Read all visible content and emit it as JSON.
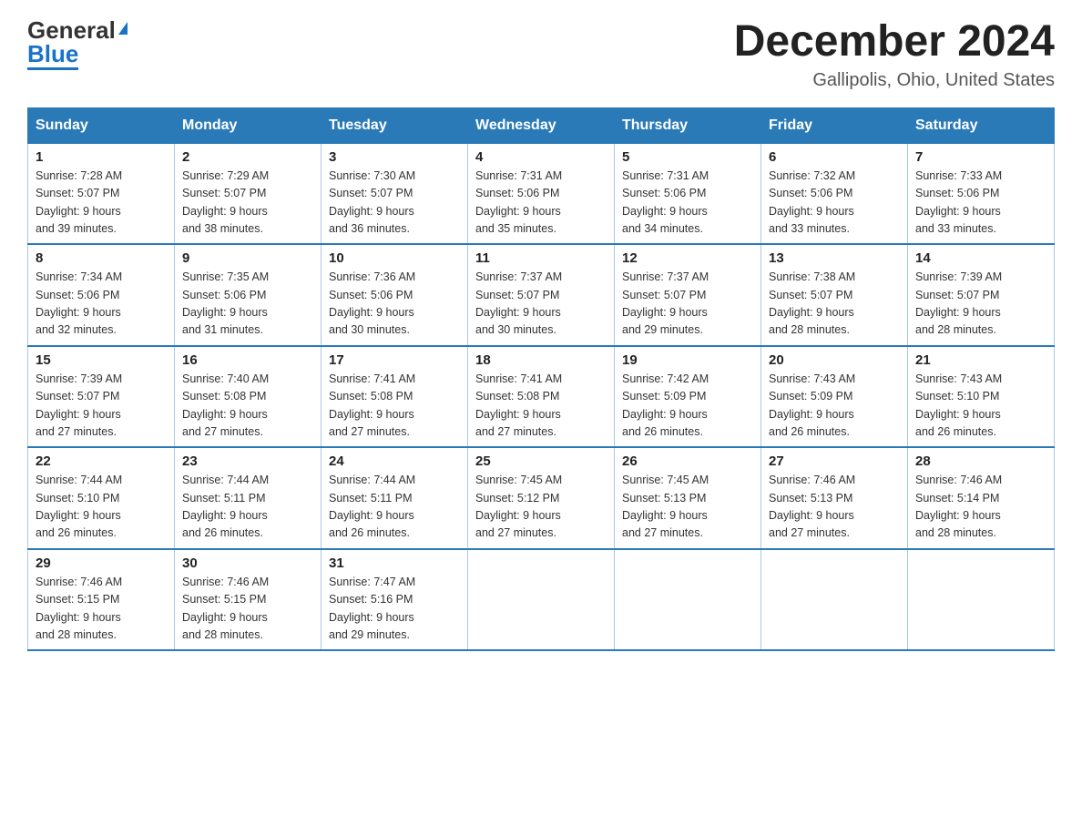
{
  "logo": {
    "general": "General",
    "blue": "Blue"
  },
  "title": "December 2024",
  "location": "Gallipolis, Ohio, United States",
  "days_of_week": [
    "Sunday",
    "Monday",
    "Tuesday",
    "Wednesday",
    "Thursday",
    "Friday",
    "Saturday"
  ],
  "weeks": [
    [
      {
        "day": "1",
        "sunrise": "7:28 AM",
        "sunset": "5:07 PM",
        "daylight": "9 hours and 39 minutes."
      },
      {
        "day": "2",
        "sunrise": "7:29 AM",
        "sunset": "5:07 PM",
        "daylight": "9 hours and 38 minutes."
      },
      {
        "day": "3",
        "sunrise": "7:30 AM",
        "sunset": "5:07 PM",
        "daylight": "9 hours and 36 minutes."
      },
      {
        "day": "4",
        "sunrise": "7:31 AM",
        "sunset": "5:06 PM",
        "daylight": "9 hours and 35 minutes."
      },
      {
        "day": "5",
        "sunrise": "7:31 AM",
        "sunset": "5:06 PM",
        "daylight": "9 hours and 34 minutes."
      },
      {
        "day": "6",
        "sunrise": "7:32 AM",
        "sunset": "5:06 PM",
        "daylight": "9 hours and 33 minutes."
      },
      {
        "day": "7",
        "sunrise": "7:33 AM",
        "sunset": "5:06 PM",
        "daylight": "9 hours and 33 minutes."
      }
    ],
    [
      {
        "day": "8",
        "sunrise": "7:34 AM",
        "sunset": "5:06 PM",
        "daylight": "9 hours and 32 minutes."
      },
      {
        "day": "9",
        "sunrise": "7:35 AM",
        "sunset": "5:06 PM",
        "daylight": "9 hours and 31 minutes."
      },
      {
        "day": "10",
        "sunrise": "7:36 AM",
        "sunset": "5:06 PM",
        "daylight": "9 hours and 30 minutes."
      },
      {
        "day": "11",
        "sunrise": "7:37 AM",
        "sunset": "5:07 PM",
        "daylight": "9 hours and 30 minutes."
      },
      {
        "day": "12",
        "sunrise": "7:37 AM",
        "sunset": "5:07 PM",
        "daylight": "9 hours and 29 minutes."
      },
      {
        "day": "13",
        "sunrise": "7:38 AM",
        "sunset": "5:07 PM",
        "daylight": "9 hours and 28 minutes."
      },
      {
        "day": "14",
        "sunrise": "7:39 AM",
        "sunset": "5:07 PM",
        "daylight": "9 hours and 28 minutes."
      }
    ],
    [
      {
        "day": "15",
        "sunrise": "7:39 AM",
        "sunset": "5:07 PM",
        "daylight": "9 hours and 27 minutes."
      },
      {
        "day": "16",
        "sunrise": "7:40 AM",
        "sunset": "5:08 PM",
        "daylight": "9 hours and 27 minutes."
      },
      {
        "day": "17",
        "sunrise": "7:41 AM",
        "sunset": "5:08 PM",
        "daylight": "9 hours and 27 minutes."
      },
      {
        "day": "18",
        "sunrise": "7:41 AM",
        "sunset": "5:08 PM",
        "daylight": "9 hours and 27 minutes."
      },
      {
        "day": "19",
        "sunrise": "7:42 AM",
        "sunset": "5:09 PM",
        "daylight": "9 hours and 26 minutes."
      },
      {
        "day": "20",
        "sunrise": "7:43 AM",
        "sunset": "5:09 PM",
        "daylight": "9 hours and 26 minutes."
      },
      {
        "day": "21",
        "sunrise": "7:43 AM",
        "sunset": "5:10 PM",
        "daylight": "9 hours and 26 minutes."
      }
    ],
    [
      {
        "day": "22",
        "sunrise": "7:44 AM",
        "sunset": "5:10 PM",
        "daylight": "9 hours and 26 minutes."
      },
      {
        "day": "23",
        "sunrise": "7:44 AM",
        "sunset": "5:11 PM",
        "daylight": "9 hours and 26 minutes."
      },
      {
        "day": "24",
        "sunrise": "7:44 AM",
        "sunset": "5:11 PM",
        "daylight": "9 hours and 26 minutes."
      },
      {
        "day": "25",
        "sunrise": "7:45 AM",
        "sunset": "5:12 PM",
        "daylight": "9 hours and 27 minutes."
      },
      {
        "day": "26",
        "sunrise": "7:45 AM",
        "sunset": "5:13 PM",
        "daylight": "9 hours and 27 minutes."
      },
      {
        "day": "27",
        "sunrise": "7:46 AM",
        "sunset": "5:13 PM",
        "daylight": "9 hours and 27 minutes."
      },
      {
        "day": "28",
        "sunrise": "7:46 AM",
        "sunset": "5:14 PM",
        "daylight": "9 hours and 28 minutes."
      }
    ],
    [
      {
        "day": "29",
        "sunrise": "7:46 AM",
        "sunset": "5:15 PM",
        "daylight": "9 hours and 28 minutes."
      },
      {
        "day": "30",
        "sunrise": "7:46 AM",
        "sunset": "5:15 PM",
        "daylight": "9 hours and 28 minutes."
      },
      {
        "day": "31",
        "sunrise": "7:47 AM",
        "sunset": "5:16 PM",
        "daylight": "9 hours and 29 minutes."
      },
      null,
      null,
      null,
      null
    ]
  ],
  "labels": {
    "sunrise": "Sunrise:",
    "sunset": "Sunset:",
    "daylight": "Daylight:"
  }
}
